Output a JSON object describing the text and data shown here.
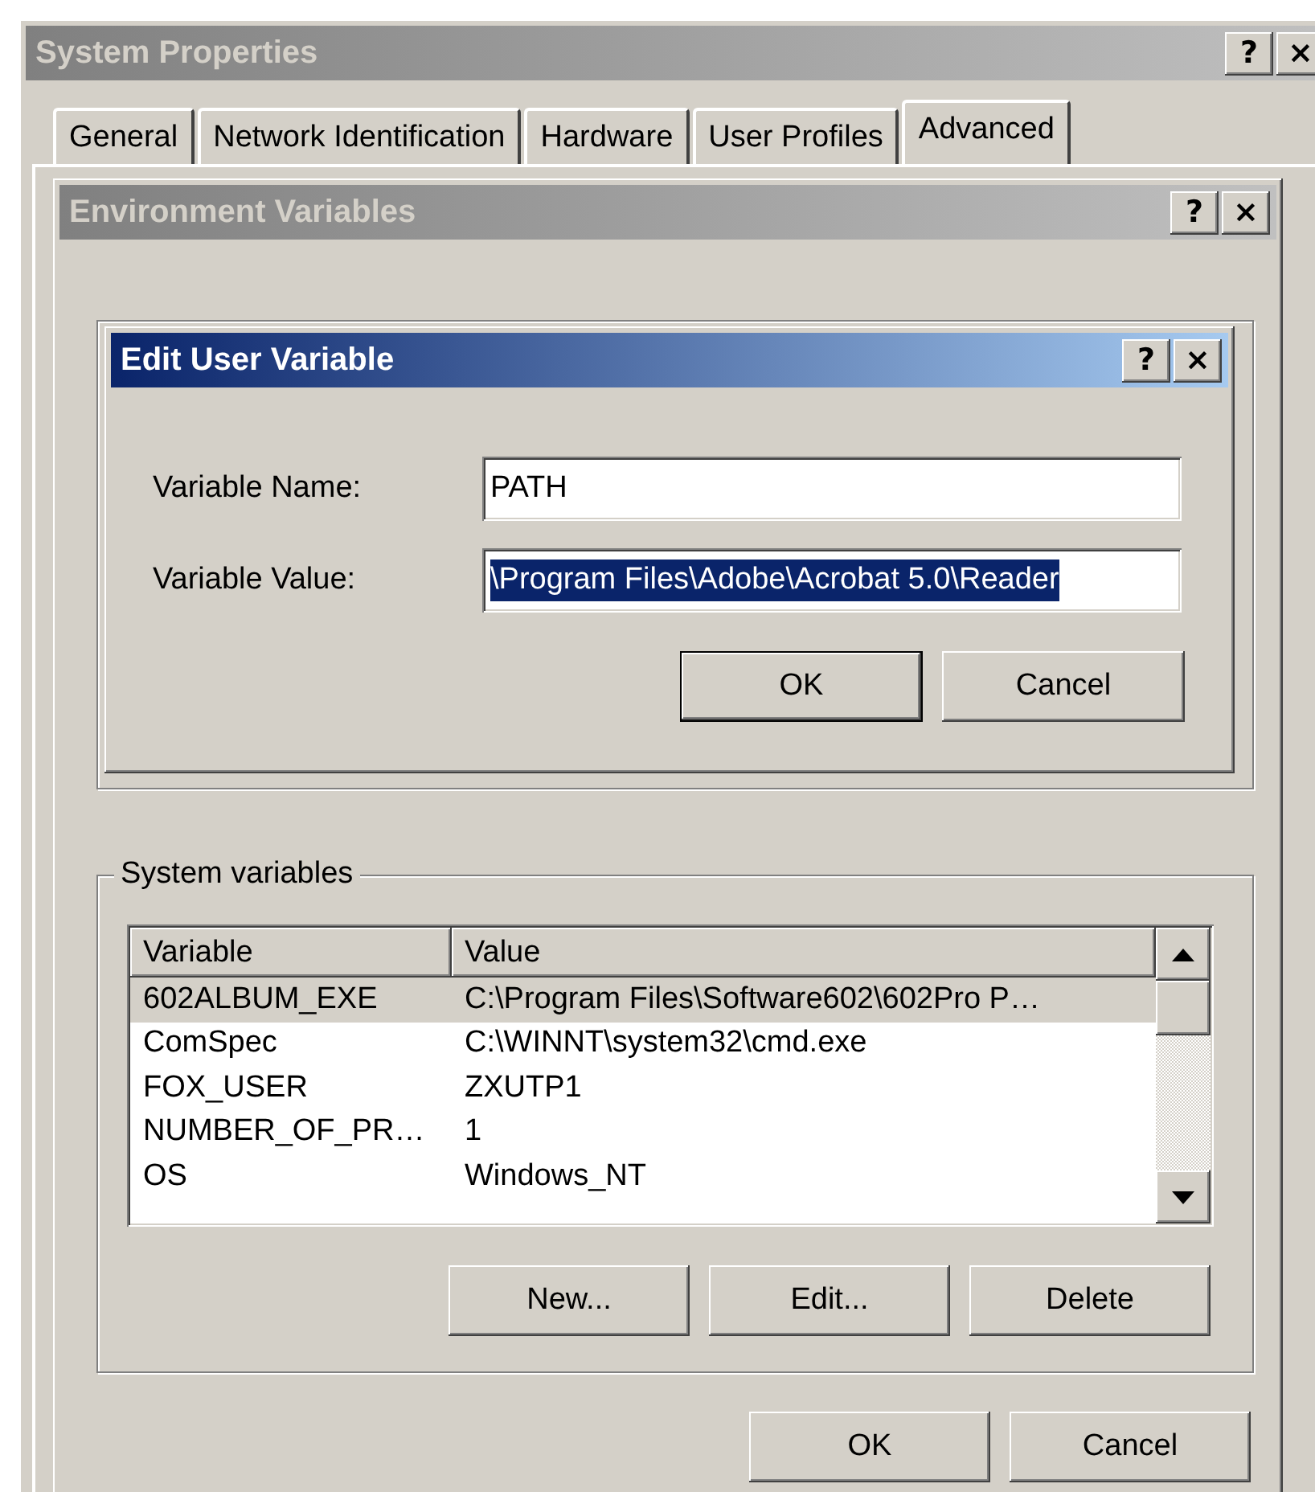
{
  "system_properties": {
    "title": "System Properties",
    "active": false,
    "title_buttons": [
      "?",
      "×"
    ],
    "tabs": [
      {
        "label": "General",
        "selected": false
      },
      {
        "label": "Network Identification",
        "selected": false
      },
      {
        "label": "Hardware",
        "selected": false
      },
      {
        "label": "User Profiles",
        "selected": false
      },
      {
        "label": "Advanced",
        "selected": true
      }
    ]
  },
  "environment_variables": {
    "title": "Environment Variables",
    "active": false,
    "title_buttons": [
      "?",
      "×"
    ],
    "system_variables": {
      "legend": "System variables",
      "columns": [
        "Variable",
        "Value"
      ],
      "rows": [
        {
          "variable": "602ALBUM_EXE",
          "value": "C:\\Program Files\\Software602\\602Pro P…",
          "selected": true
        },
        {
          "variable": "ComSpec",
          "value": "C:\\WINNT\\system32\\cmd.exe",
          "selected": false
        },
        {
          "variable": "FOX_USER",
          "value": "ZXUTP1",
          "selected": false
        },
        {
          "variable": "NUMBER_OF_PR…",
          "value": "1",
          "selected": false
        },
        {
          "variable": "OS",
          "value": "Windows_NT",
          "selected": false
        }
      ],
      "buttons": [
        "New...",
        "Edit...",
        "Delete"
      ]
    },
    "buttons": [
      "OK",
      "Cancel"
    ]
  },
  "edit_user_variable": {
    "title": "Edit User Variable",
    "active": true,
    "title_buttons": [
      "?",
      "×"
    ],
    "fields": [
      {
        "label": "Variable Name:",
        "value": "PATH",
        "selected": false
      },
      {
        "label": "Variable Value:",
        "value": "\\Program Files\\Adobe\\Acrobat 5.0\\Reader",
        "selected": true
      }
    ],
    "buttons": [
      {
        "label": "OK",
        "default": true
      },
      {
        "label": "Cancel",
        "default": false
      }
    ]
  }
}
